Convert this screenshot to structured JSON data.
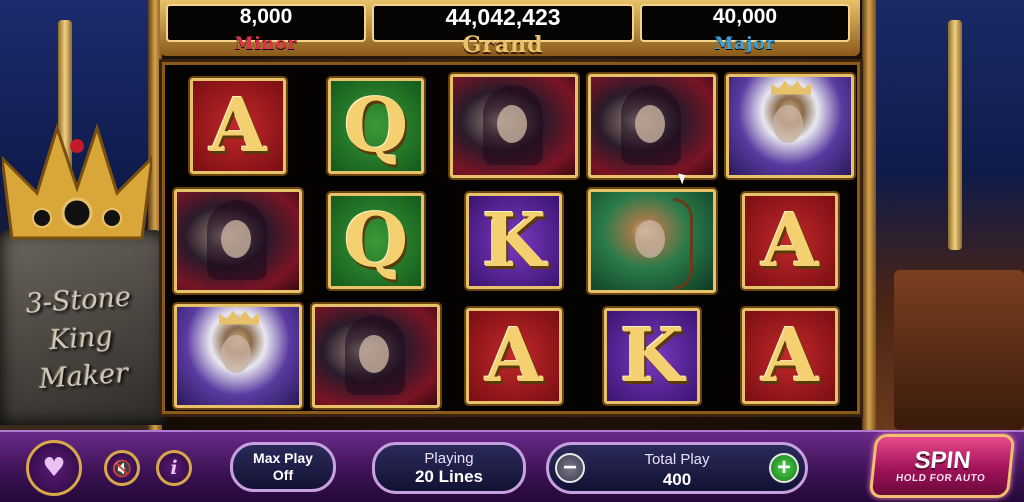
{
  "game": {
    "title_lines": [
      "3-Stone",
      "King",
      "Maker"
    ]
  },
  "jackpots": {
    "minor": {
      "value": "8,000",
      "label": "Minor"
    },
    "grand": {
      "value": "44,042,423",
      "label": "Grand"
    },
    "major": {
      "value": "40,000",
      "label": "Major"
    }
  },
  "reels": [
    [
      {
        "symbol": "A",
        "kind": "letter",
        "color": "red"
      },
      {
        "symbol": "Q",
        "kind": "letter",
        "color": "green"
      },
      {
        "symbol": "sorcerer",
        "kind": "picture"
      },
      {
        "symbol": "sorcerer",
        "kind": "picture"
      },
      {
        "symbol": "king",
        "kind": "picture"
      }
    ],
    [
      {
        "symbol": "sorcerer",
        "kind": "picture"
      },
      {
        "symbol": "Q",
        "kind": "letter",
        "color": "green"
      },
      {
        "symbol": "K",
        "kind": "letter",
        "color": "purple"
      },
      {
        "symbol": "archer",
        "kind": "picture"
      },
      {
        "symbol": "A",
        "kind": "letter",
        "color": "red"
      }
    ],
    [
      {
        "symbol": "king",
        "kind": "picture"
      },
      {
        "symbol": "sorcerer",
        "kind": "picture"
      },
      {
        "symbol": "A",
        "kind": "letter",
        "color": "red"
      },
      {
        "symbol": "K",
        "kind": "letter",
        "color": "purple"
      },
      {
        "symbol": "A",
        "kind": "letter",
        "color": "red"
      }
    ]
  ],
  "controls": {
    "favorite_icon": "heart-icon",
    "mute_icon": "speaker-muted-icon",
    "info_label": "i",
    "max_play": {
      "line1": "Max Play",
      "line2": "Off"
    },
    "lines": {
      "label": "Playing",
      "value": "20 Lines"
    },
    "total_play": {
      "label": "Total Play",
      "value": "400",
      "minus": "−",
      "plus": "+"
    },
    "spin": {
      "label": "SPIN",
      "sub": "HOLD FOR AUTO"
    }
  },
  "colors": {
    "minor": "#e0344a",
    "grand": "#e9c26a",
    "major": "#3aa2e0",
    "spin": "#c8196a",
    "frame_gold": "#e8c26a"
  }
}
